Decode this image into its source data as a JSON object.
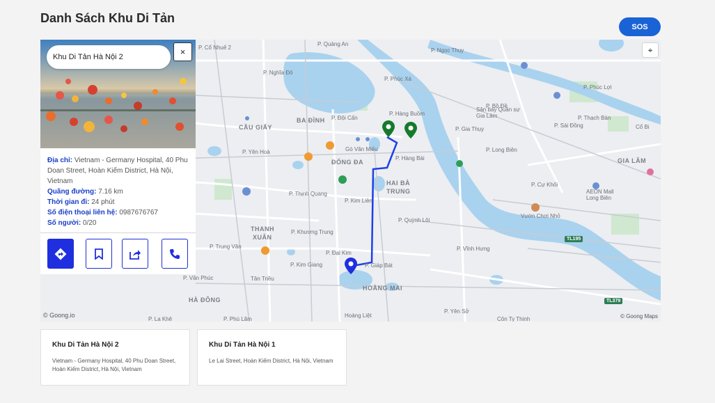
{
  "page_title": "Danh Sách Khu Di Tản",
  "sos_label": "SOS",
  "colors": {
    "primary": "#1f2fdf",
    "sos": "#1a63d6",
    "route": "#1f3fe8",
    "marker_green": "#167a2c",
    "marker_blue": "#1f2fdf",
    "water": "#a9d2ef"
  },
  "search": {
    "value": "Khu Di Tản Hà Nội 2"
  },
  "close_label": "×",
  "info": {
    "address_label": "Địa chỉ:",
    "address_value": "Vietnam - Germany Hospital, 40 Phu Doan Street, Hoàn Kiếm District, Hà Nội, Vietnam",
    "distance_label": "Quãng đường:",
    "distance_value": "7.16 km",
    "time_label": "Thời gian đi:",
    "time_value": "24 phút",
    "phone_label": "Số điện thoại liên hệ:",
    "phone_value": "0987676767",
    "people_label": "Số người:",
    "people_value": "0/20"
  },
  "actions": [
    {
      "name": "directions-icon"
    },
    {
      "name": "bookmark-icon"
    },
    {
      "name": "share-icon"
    },
    {
      "name": "phone-icon"
    }
  ],
  "map": {
    "labels": {
      "cau_giay": "CẦU GIẤY",
      "ba_dinh": "BA ĐÌNH",
      "dong_da": "ĐỐNG ĐA",
      "hai_ba_trung": "HAI BÀ",
      "trung": "TRUNG",
      "thanh_xuan": "THANH",
      "xuan": "XUÂN",
      "hoang_mai": "HOÀNG MAI",
      "ha_dong": "HÀ ĐÔNG",
      "gia_lam": "GIA LÂM",
      "tan_trieu": "Tân Triều",
      "co_nhue": "P. Cổ Nhuế 2",
      "nghia_do": "P. Nghĩa Đô",
      "yen_hoa": "P. Yên Hoà",
      "quang_an": "P. Quảng An",
      "phuc_xa": "P. Phúc Xá",
      "ngoc_thuy": "P. Ngọc Thụy",
      "hang_buom": "P. Hàng Buồm",
      "doi_can": "P. Đội Cấn",
      "van_mieu": "Gò Văn Miếu",
      "hang_bai": "P. Hàng Bài",
      "kim_lien": "P. Kim Liên",
      "thinh_quang": "P. Thịnh Quang",
      "quynh_loi": "P. Quỳnh Lôi",
      "khuong_trung": "P. Khương Trung",
      "trung_van": "P. Trung Văn",
      "kim_giang": "P. Kim Giang",
      "giap_bat": "P. Giáp Bát",
      "vinh_hung": "P. Vĩnh Hưng",
      "yen_so": "P. Yên Sở",
      "van_phuc": "P. Văn Phúc",
      "la_khe": "P. La Khê",
      "long_bien": "P. Long Biên",
      "bo_de": "P. Bồ Đề",
      "phuc_loi": "P. Phúc Lợi",
      "cu_khoi": "P. Cự Khối",
      "dai_kim": "P. Đại Kim",
      "thach_ban": "P. Thạch Bàn",
      "co_bi": "Cổ Bi",
      "sai_dong": "P. Sài Đồng",
      "gia_thuy": "P. Gia Thụy",
      "san_bay": "Sân bay Quân sự Gia Lâm",
      "vuon_choi": "Vườn Chơi Nhỏ",
      "aeon": "AEON Mall Long Biên",
      "linh_dam": "Hoàng Liệt",
      "phu_lam": "P. Phú Lãm",
      "tu_hiep": "Côn Ty Thinh"
    },
    "road_badges": [
      "TL195",
      "TL379"
    ],
    "attribution_left": "© Goong.io",
    "attribution_right": "© Goong Maps",
    "locate_icon": "⌖"
  },
  "cards": [
    {
      "title": "Khu Di Tản Hà Nội 2",
      "address": "Vietnam - Germany Hospital, 40 Phu Doan Street, Hoàn Kiếm District, Hà Nội, Vietnam"
    },
    {
      "title": "Khu Di Tản Hà Nội 1",
      "address": "Le Lai Street, Hoàn Kiếm District, Hà Nội, Vietnam"
    }
  ]
}
